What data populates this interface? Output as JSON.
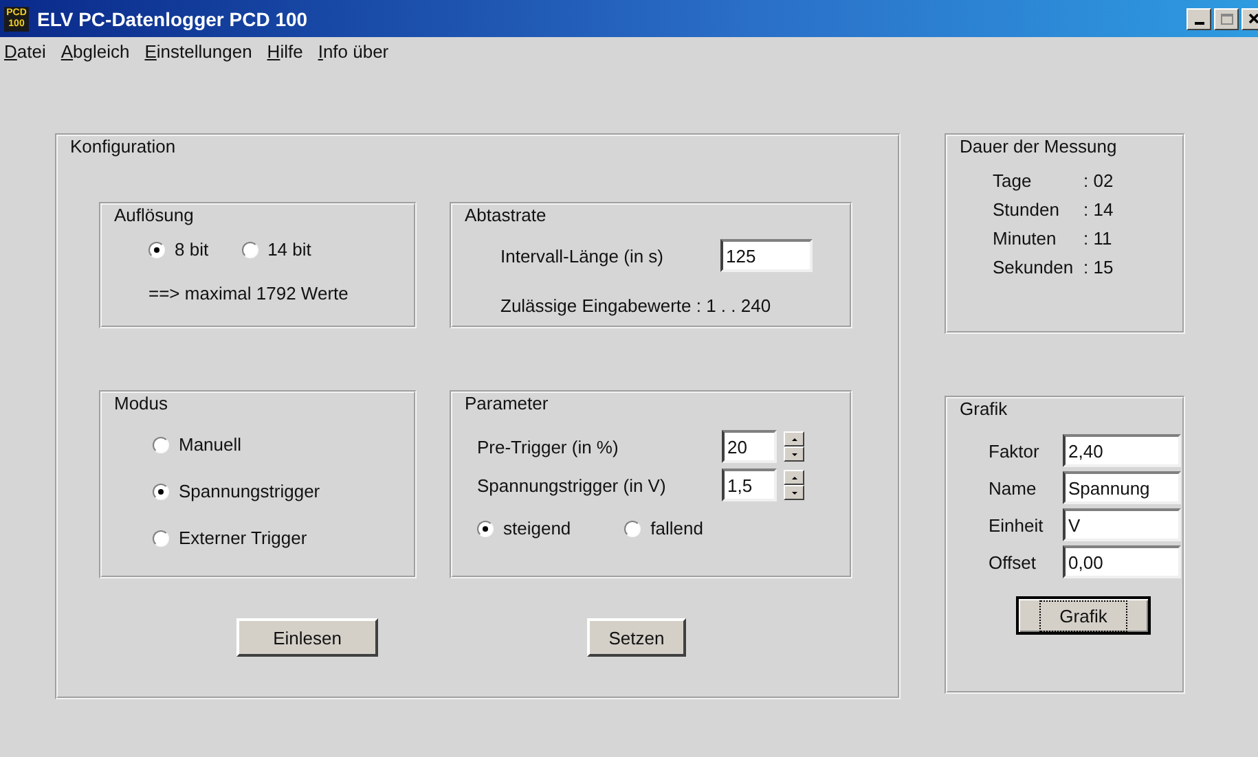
{
  "window": {
    "icon_text": [
      "PCD",
      "100"
    ],
    "title": "ELV PC-Datenlogger PCD 100",
    "controls": [
      {
        "kind": "minimize"
      },
      {
        "kind": "maximize"
      },
      {
        "kind": "close"
      }
    ]
  },
  "menu": [
    "Datei",
    "Abgleich",
    "Einstellungen",
    "Hilfe",
    "Info über"
  ],
  "configuration": {
    "title": "Konfiguration",
    "resolution": {
      "title": "Auflösung",
      "options": [
        {
          "label": "8 bit",
          "selected": true
        },
        {
          "label": "14 bit",
          "selected": false
        }
      ],
      "note": "==> maximal 1792 Werte"
    },
    "sampling": {
      "title": "Abtastrate",
      "label": "Intervall-Länge (in s)",
      "value": "125",
      "note": "Zulässige Eingabewerte : 1 . . 240"
    },
    "mode": {
      "title": "Modus",
      "options": [
        {
          "label": "Manuell",
          "selected": false
        },
        {
          "label": "Spannungstrigger",
          "selected": true
        },
        {
          "label": "Externer Trigger",
          "selected": false
        }
      ]
    },
    "parameters": {
      "title": "Parameter",
      "fields": [
        {
          "label": "Pre-Trigger (in %)",
          "value": "20"
        },
        {
          "label": "Spannungstrigger (in V)",
          "value": "1,5"
        }
      ],
      "edge": [
        {
          "label": "steigend",
          "selected": true
        },
        {
          "label": "fallend",
          "selected": false
        }
      ]
    },
    "buttons": [
      {
        "label": "Einlesen",
        "focused": false
      },
      {
        "label": "Setzen",
        "focused": false
      }
    ]
  },
  "duration": {
    "title": "Dauer der Messung",
    "rows": [
      {
        "label": "Tage",
        "value": ": 02"
      },
      {
        "label": "Stunden",
        "value": ": 14"
      },
      {
        "label": "Minuten",
        "value": ": 11"
      },
      {
        "label": "Sekunden",
        "value": ": 15"
      }
    ]
  },
  "graphic": {
    "title": "Grafik",
    "fields": [
      {
        "label": "Faktor",
        "value": "2,40"
      },
      {
        "label": "Name",
        "value": "Spannung"
      },
      {
        "label": "Einheit",
        "value": "V"
      },
      {
        "label": "Offset",
        "value": "0,00"
      }
    ],
    "button": {
      "label": "Grafik",
      "focused": true
    }
  }
}
